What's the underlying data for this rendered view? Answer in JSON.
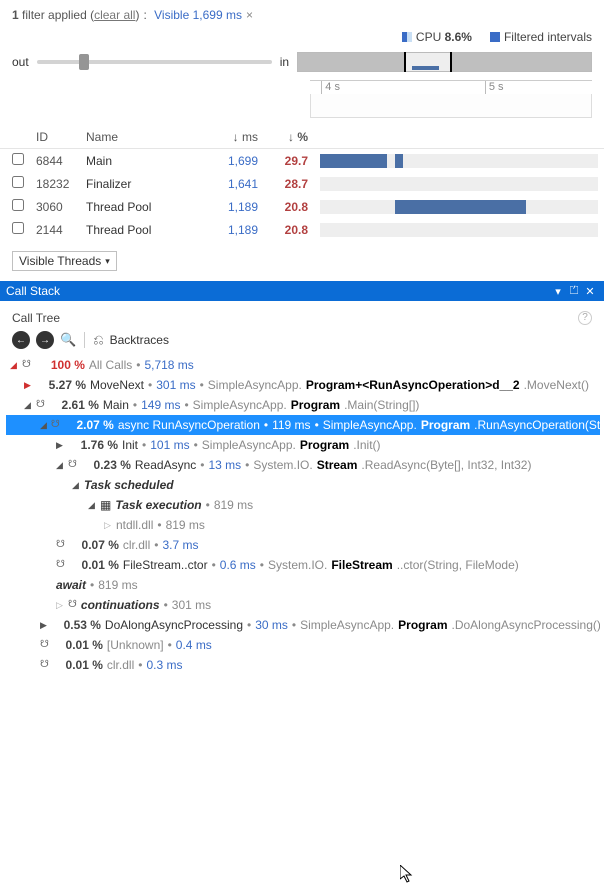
{
  "filter": {
    "count": "1",
    "applied_text": "filter applied",
    "clear_text": "clear all",
    "pill_label": "Visible 1,699 ms"
  },
  "cpu": {
    "label": "CPU",
    "value": "8.6%",
    "filtered_label": "Filtered intervals"
  },
  "slider": {
    "out": "out",
    "in": "in"
  },
  "ruler": {
    "t1": "4 s",
    "t2": "5 s"
  },
  "threads_header": {
    "id": "ID",
    "name": "Name",
    "ms": "↓ ms",
    "pc": "↓ %"
  },
  "threads": [
    {
      "id": "6844",
      "name": "Main",
      "ms": "1,699",
      "pc": "29.7",
      "segs": [
        [
          0,
          24
        ],
        [
          27,
          3
        ]
      ]
    },
    {
      "id": "18232",
      "name": "Finalizer",
      "ms": "1,641",
      "pc": "28.7",
      "segs": []
    },
    {
      "id": "3060",
      "name": "Thread Pool",
      "ms": "1,189",
      "pc": "20.8",
      "segs": [
        [
          27,
          47
        ]
      ]
    },
    {
      "id": "2144",
      "name": "Thread Pool",
      "ms": "1,189",
      "pc": "20.8",
      "segs": []
    }
  ],
  "vt_dropdown": "Visible Threads",
  "callstack_title": "Call Stack",
  "calltree_label": "Call Tree",
  "toolbar": {
    "backtraces": "Backtraces"
  },
  "tree": {
    "all": {
      "pc": "100 %",
      "label": "All Calls",
      "ms": "5,718 ms"
    },
    "movenext": {
      "pc": "5.27 %",
      "name": "MoveNext",
      "ms": "301 ms",
      "ns": "SimpleAsyncApp.",
      "cls": "Program+<RunAsyncOperation>d__2",
      "meth": ".MoveNext()"
    },
    "main": {
      "pc": "2.61 %",
      "name": "Main",
      "ms": "149 ms",
      "ns": "SimpleAsyncApp.",
      "cls": "Program",
      "meth": ".Main(String[])"
    },
    "rao": {
      "pc": "2.07 %",
      "name": "async RunAsyncOperation",
      "ms": "119 ms",
      "ns": "SimpleAsyncApp.",
      "cls": "Program",
      "meth": ".RunAsyncOperation(String)"
    },
    "init": {
      "pc": "1.76 %",
      "name": "Init",
      "ms": "101 ms",
      "ns": "SimpleAsyncApp.",
      "cls": "Program",
      "meth": ".Init()"
    },
    "readasync": {
      "pc": "0.23 %",
      "name": "ReadAsync",
      "ms": "13 ms",
      "ns": "System.IO.",
      "cls": "Stream",
      "meth": ".ReadAsync(Byte[], Int32, Int32)"
    },
    "tasksched": {
      "label": "Task scheduled"
    },
    "taskexec": {
      "label": "Task execution",
      "ms": "819 ms"
    },
    "ntdll": {
      "name": "ntdll.dll",
      "ms": "819 ms"
    },
    "clr1": {
      "pc": "0.07 %",
      "name": "clr.dll",
      "ms": "3.7 ms"
    },
    "fsctor": {
      "pc": "0.01 %",
      "name": "FileStream..ctor",
      "ms": "0.6 ms",
      "ns": "System.IO.",
      "cls": "FileStream",
      "meth": "..ctor(String, FileMode)"
    },
    "await": {
      "label": "await",
      "ms": "819 ms"
    },
    "cont": {
      "label": "continuations",
      "ms": "301 ms"
    },
    "doalong": {
      "pc": "0.53 %",
      "name": "DoAlongAsyncProcessing",
      "ms": "30 ms",
      "ns": "SimpleAsyncApp.",
      "cls": "Program",
      "meth": ".DoAlongAsyncProcessing()"
    },
    "unk": {
      "pc": "0.01 %",
      "name": "[Unknown]",
      "ms": "0.4 ms"
    },
    "clr2": {
      "pc": "0.01 %",
      "name": "clr.dll",
      "ms": "0.3 ms"
    }
  }
}
